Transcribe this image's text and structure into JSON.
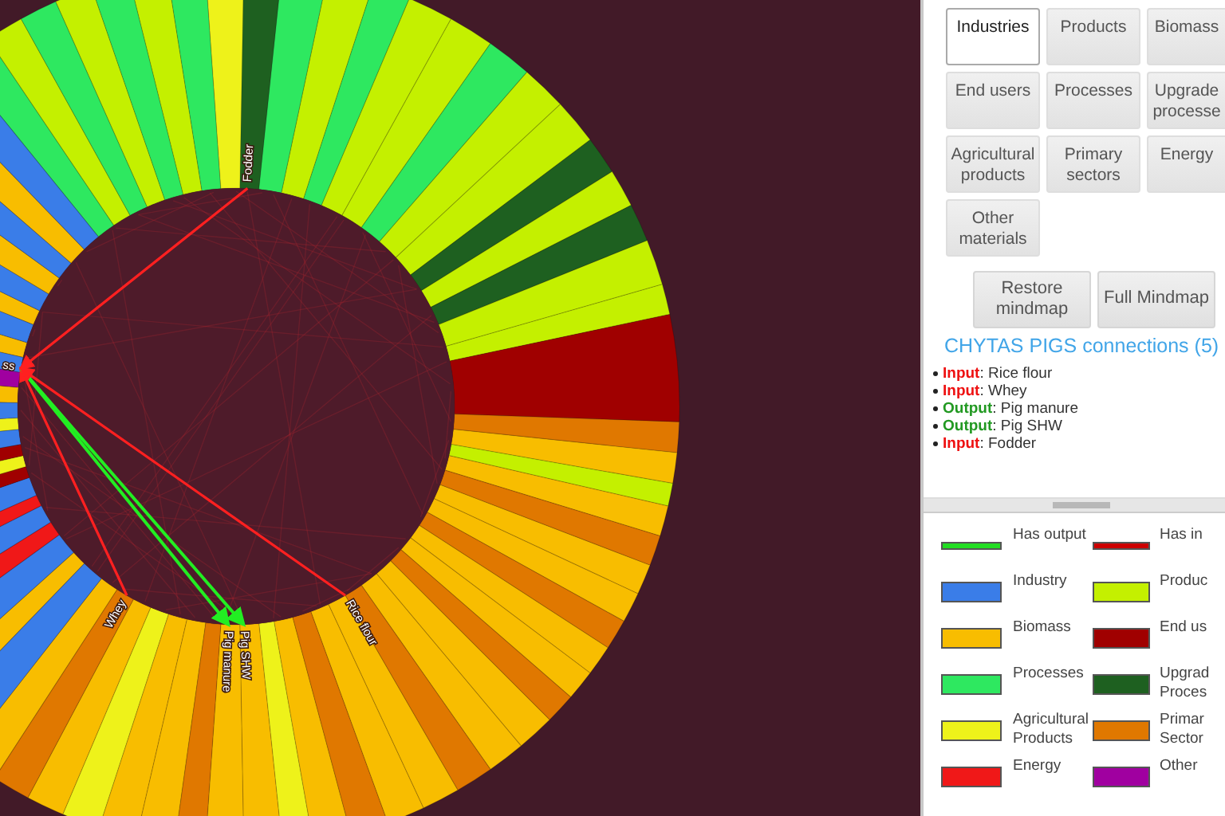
{
  "wheel": {
    "center_label": "ss",
    "nodes": [
      {
        "label": "Fodder",
        "kind": "input"
      },
      {
        "label": "Whey",
        "kind": "input"
      },
      {
        "label": "Pig manure",
        "kind": "output"
      },
      {
        "label": "Pig SHW",
        "kind": "output"
      },
      {
        "label": "Rice flour",
        "kind": "input"
      }
    ]
  },
  "categories": [
    {
      "label": "Industries",
      "selected": true
    },
    {
      "label": "Products",
      "selected": false
    },
    {
      "label": "Biomass",
      "selected": false
    },
    {
      "label": "End users",
      "selected": false
    },
    {
      "label": "Processes",
      "selected": false
    },
    {
      "label": "Upgrade processe",
      "selected": false
    },
    {
      "label": "Agricultural products",
      "selected": false
    },
    {
      "label": "Primary sectors",
      "selected": false
    },
    {
      "label": "Energy",
      "selected": false
    },
    {
      "label": "Other materials",
      "selected": false
    }
  ],
  "actions": [
    "Restore mindmap",
    "Full Mindmap"
  ],
  "connections": {
    "title": "CHYTAS PIGS connections (5)",
    "items": [
      {
        "kind": "input",
        "text": "**Input**: Rice flour"
      },
      {
        "kind": "input",
        "text": "**Input**: Whey"
      },
      {
        "kind": "output",
        "text": "**Output**: Pig manure"
      },
      {
        "kind": "output",
        "text": "**Output**: Pig SHW"
      },
      {
        "kind": "input",
        "text": "**Input**: Fodder"
      }
    ]
  },
  "legend": [
    {
      "kind": "line",
      "label": "Has output",
      "color": "#22dd22"
    },
    {
      "kind": "line",
      "label": "Has in",
      "color": "#cc0000"
    },
    {
      "kind": "swatch",
      "label": "Industry",
      "color": "#3a7de8"
    },
    {
      "kind": "swatch",
      "label": "Produc",
      "color": "#c4f000"
    },
    {
      "kind": "swatch",
      "label": "Biomass",
      "color": "#f8bd00"
    },
    {
      "kind": "swatch",
      "label": "End us",
      "color": "#a00000"
    },
    {
      "kind": "swatch",
      "label": "Processes",
      "color": "#2ee860"
    },
    {
      "kind": "swatch",
      "label": "Upgrad Proces",
      "color": "#1e6020"
    },
    {
      "kind": "swatch",
      "label": "Agricultural Products",
      "color": "#eef21a"
    },
    {
      "kind": "swatch",
      "label": "Primar Sector",
      "color": "#e07800"
    },
    {
      "kind": "swatch",
      "label": "Energy",
      "color": "#f01818"
    },
    {
      "kind": "swatch",
      "label": "Other",
      "color": "#a000a0"
    }
  ]
}
